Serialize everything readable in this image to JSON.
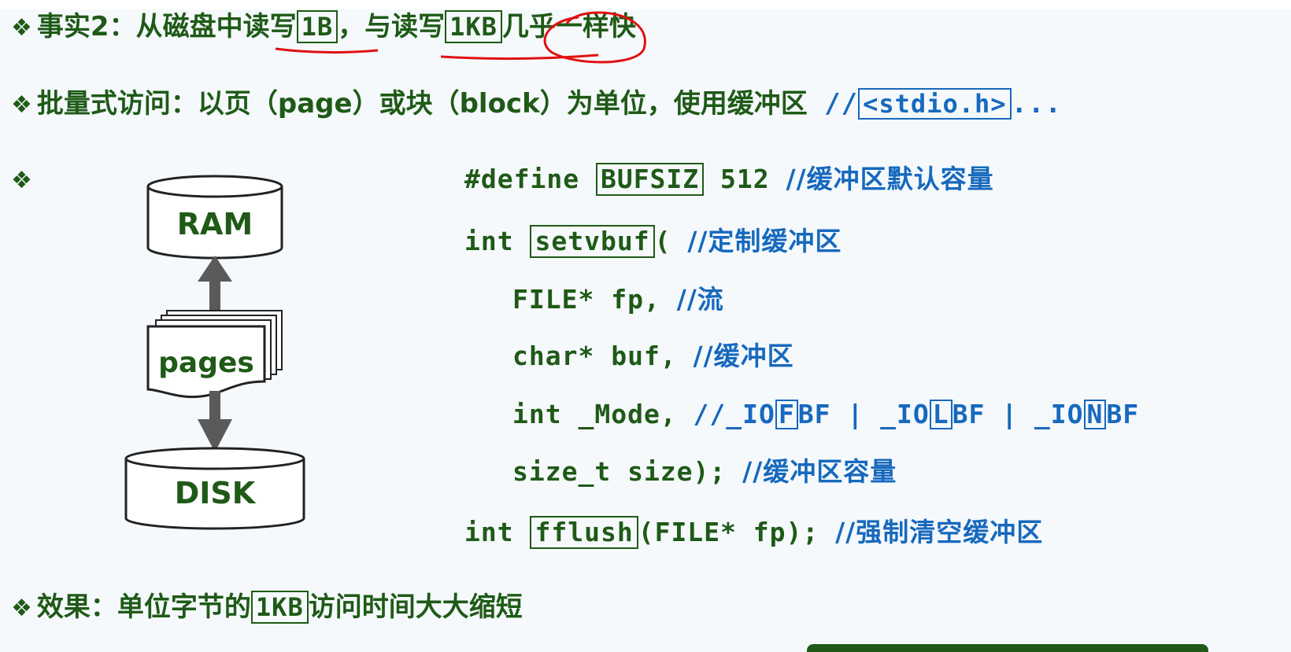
{
  "line1": {
    "bullet": "❖",
    "part1": "事实2：从磁盘中读写",
    "box1": "1B",
    "part2": "，与读写",
    "box2": "1KB",
    "part3": "几乎一样快"
  },
  "line2": {
    "bullet": "❖",
    "part1": "批量式访问：以页（page）或块（block）为单位，使用缓冲区",
    "slashes": " //",
    "header_box": "<stdio.h>",
    "ellipsis": "..."
  },
  "line3": {
    "bullet": "❖"
  },
  "diagram": {
    "top_label": "RAM",
    "middle_label": "pages",
    "bottom_label": "DISK"
  },
  "code": {
    "l1_pre": "#define ",
    "l1_box": "BUFSIZ",
    "l1_post": " 512 ",
    "l1_comment": "//缓冲区默认容量",
    "l2_pre": "int ",
    "l2_box": "setvbuf",
    "l2_post": "( ",
    "l2_comment": "//定制缓冲区",
    "l3_code": "FILE* fp, ",
    "l3_comment": "//流",
    "l4_code": "char* buf, ",
    "l4_comment": "//缓冲区",
    "l5_code": "int _Mode, ",
    "l5_c1": "//_IO",
    "l5_b1": "F",
    "l5_c2": "BF | _IO",
    "l5_b2": "L",
    "l5_c3": "BF | _IO",
    "l5_b3": "N",
    "l5_c4": "BF",
    "l6_code": "size_t size); ",
    "l6_comment": "//缓冲区容量",
    "l7_pre": "int ",
    "l7_box": "fflush",
    "l7_post": "(FILE* fp); ",
    "l7_comment": "//强制清空缓冲区"
  },
  "line4": {
    "bullet": "❖",
    "part1": "效果：单位字节的",
    "box": "1KB",
    "part2": "访问时间大大缩短"
  },
  "colors": {
    "text_green": "#1f5a17",
    "comment_blue": "#1769bd",
    "annotation_red": "#e01010",
    "arrow_gray": "#5a5a5a",
    "background": "#f5f9fc"
  }
}
